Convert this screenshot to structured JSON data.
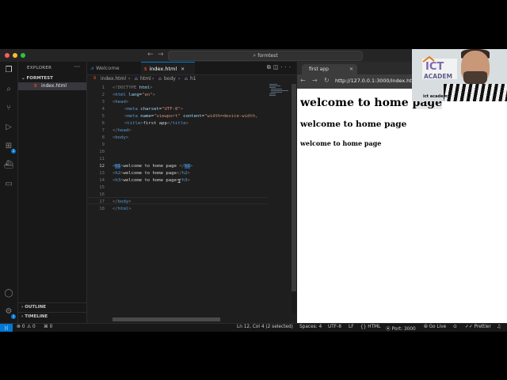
{
  "window": {
    "title": "formtest"
  },
  "sidebar": {
    "header": "EXPLORER",
    "folder": "FORMTEST",
    "file": "index.html",
    "outline": "OUTLINE",
    "timeline": "TIMELINE"
  },
  "tabs": [
    {
      "label": "Welcome",
      "icon": "vscode-icon"
    },
    {
      "label": "index.html",
      "icon": "html-file-icon",
      "active": true
    }
  ],
  "breadcrumb": [
    "index.html",
    "html",
    "body",
    "h1"
  ],
  "code": {
    "line_numbers": [
      "1",
      "2",
      "3",
      "4",
      "5",
      "6",
      "7",
      "8",
      "9",
      "10",
      "11",
      "12",
      "13",
      "14",
      "15",
      "16",
      "17",
      "18"
    ],
    "current_line": 12,
    "lines": {
      "l1": {
        "a": "<!DOCTYPE ",
        "b": "html",
        "c": ">"
      },
      "l2": {
        "a": "<",
        "b": "html",
        "c": " lang",
        "d": "=",
        "e": "\"en\"",
        "f": ">"
      },
      "l3": {
        "a": "<",
        "b": "head",
        "c": ">"
      },
      "l4": {
        "a": "<",
        "b": "meta",
        "c": " charset",
        "d": "=",
        "e": "\"UTF-8\"",
        "f": ">"
      },
      "l5": {
        "a": "<",
        "b": "meta",
        "c": " name",
        "d": "=",
        "e": "\"viewport\"",
        "g": " content",
        "h": "=",
        "i": "\"width=device-width,"
      },
      "l6": {
        "a": "<",
        "b": "title",
        "c": ">",
        "d": "first app",
        "e": "</",
        "f": "title",
        "g": ">"
      },
      "l7": {
        "a": "</",
        "b": "head",
        "c": ">"
      },
      "l8": {
        "a": "<",
        "b": "body",
        "c": ">"
      },
      "l12": {
        "a": "<",
        "b": "h1",
        "c": ">",
        "d": "welcome to home page ",
        "e": "</",
        "f": "h1",
        "g": ">"
      },
      "l13": {
        "a": "<",
        "b": "h2",
        "c": ">",
        "d": "welcome to home page",
        "e": "</",
        "f": "h2",
        "g": ">"
      },
      "l14": {
        "a": "<",
        "b": "h3",
        "c": ">",
        "d": "welcome to home page",
        "e": "</",
        "f": "h3",
        "g": ">"
      },
      "l17": {
        "a": "</",
        "b": "body",
        "c": ">"
      },
      "l18": {
        "a": "</",
        "b": "html",
        "c": ">"
      }
    }
  },
  "browser": {
    "tab_title": "first app",
    "url": "http://127.0.0.1:3000/index.html",
    "h1": "welcome to home",
    "h1_sel": "page",
    "h2": "welcome to home page",
    "h3": "welcome to home page"
  },
  "webcam": {
    "caption": "ict academy",
    "logo_text": "ICT",
    "logo_sub": "ACADEM"
  },
  "statusbar": {
    "errors": "0",
    "warnings": "0",
    "ports": "0",
    "position": "Ln 12, Col 4 (2 selected)",
    "spaces": "Spaces: 4",
    "encoding": "UTF-8",
    "eol": "LF",
    "language": "HTML",
    "port": "Port: 3000",
    "golive": "Go Live",
    "prettier": "Prettier"
  },
  "colors": {
    "accent": "#0078d4",
    "tag": "#569cd6",
    "attr": "#9cdcfe",
    "string": "#ce9178",
    "editor_bg": "#1e1e1e"
  }
}
